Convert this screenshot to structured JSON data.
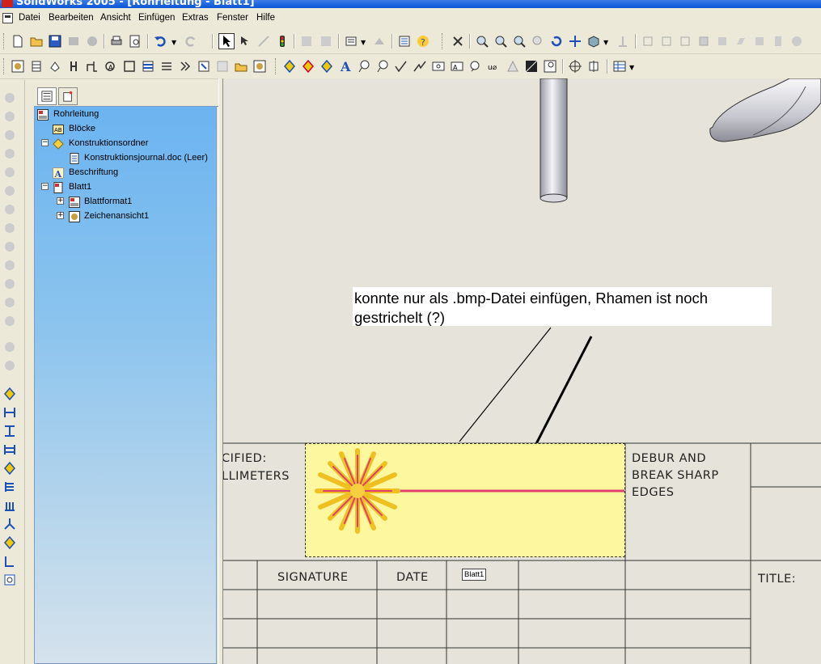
{
  "window": {
    "title": "SolidWorks 2005 - [Rohrleitung - Blatt1]"
  },
  "menubar": {
    "items": [
      "Datei",
      "Bearbeiten",
      "Ansicht",
      "Einfügen",
      "Extras",
      "Fenster",
      "Hilfe"
    ]
  },
  "feature_tree": {
    "root": "Rohrleitung",
    "nodes": [
      {
        "label": "Blöcke",
        "icon": "blocks-icon"
      },
      {
        "label": "Konstruktionsordner",
        "icon": "design-folder-icon",
        "expanded": true
      },
      {
        "label": "Konstruktionsjournal.doc (Leer)",
        "icon": "journal-doc-icon"
      },
      {
        "label": "Beschriftung",
        "icon": "annotation-icon"
      },
      {
        "label": "Blatt1",
        "icon": "sheet-icon",
        "expanded": true
      },
      {
        "label": "Blattformat1",
        "icon": "sheet-format-icon",
        "expanded": false
      },
      {
        "label": "Zeichenansicht1",
        "icon": "drawing-view-icon",
        "expanded": false
      }
    ]
  },
  "drawing": {
    "callout_text": "konnte nur als .bmp-Datei einfügen, Rhamen ist noch gestrichelt (?)",
    "title_block": {
      "cified": "CIFIED:",
      "llimeters": "LLIMETERS",
      "debur_1": "DEBUR AND",
      "debur_2": "BREAK SHARP",
      "debur_3": "EDGES",
      "signature": "SIGNATURE",
      "date": "DATE",
      "title": "TITLE:"
    },
    "sheet_tag": "Blatt1"
  },
  "colors": {
    "titlebar": "#0b56d6",
    "tree_bg": "#6cb4f0",
    "bmp_bg": "#fdf8a0"
  }
}
